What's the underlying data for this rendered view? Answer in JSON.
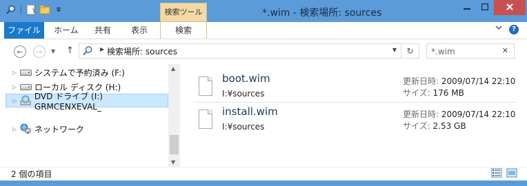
{
  "window": {
    "title": "*.wim - 検索場所: sources",
    "context_tab_group": "検索ツール",
    "colors": {
      "frame": "#5b9bd9",
      "file_tab": "#1979ca",
      "context_tab": "#f3d9a5",
      "selection": "#cce8ff"
    }
  },
  "ribbon": {
    "tabs": [
      {
        "label": "ファイル",
        "active": false
      },
      {
        "label": "ホーム"
      },
      {
        "label": "共有"
      },
      {
        "label": "表示"
      },
      {
        "label": "検索"
      }
    ]
  },
  "address_bar": {
    "path": "検索場所: sources",
    "search_value": "*.wim"
  },
  "nav_pane": {
    "items": [
      {
        "label": "システムで予約済み (F:)",
        "icon": "drive-icon"
      },
      {
        "label": "ローカル ディスク (H:)",
        "icon": "drive-icon"
      },
      {
        "label": "DVD ドライブ (I:) GRMCENXEVAL_",
        "icon": "dvd-drive-icon",
        "selected": true
      },
      {
        "label": "ネットワーク",
        "icon": "network-icon"
      }
    ]
  },
  "results": [
    {
      "name": "boot.wim",
      "location": "I:¥sources",
      "modified_label": "更新日時:",
      "modified": "2009/07/14 22:10",
      "size_label": "サイズ:",
      "size": "176 MB"
    },
    {
      "name": "install.wim",
      "location": "I:¥sources",
      "modified_label": "更新日時:",
      "modified": "2009/07/14 22:10",
      "size_label": "サイズ:",
      "size": "2.53 GB"
    }
  ],
  "status": {
    "item_count": "2 個の項目"
  }
}
